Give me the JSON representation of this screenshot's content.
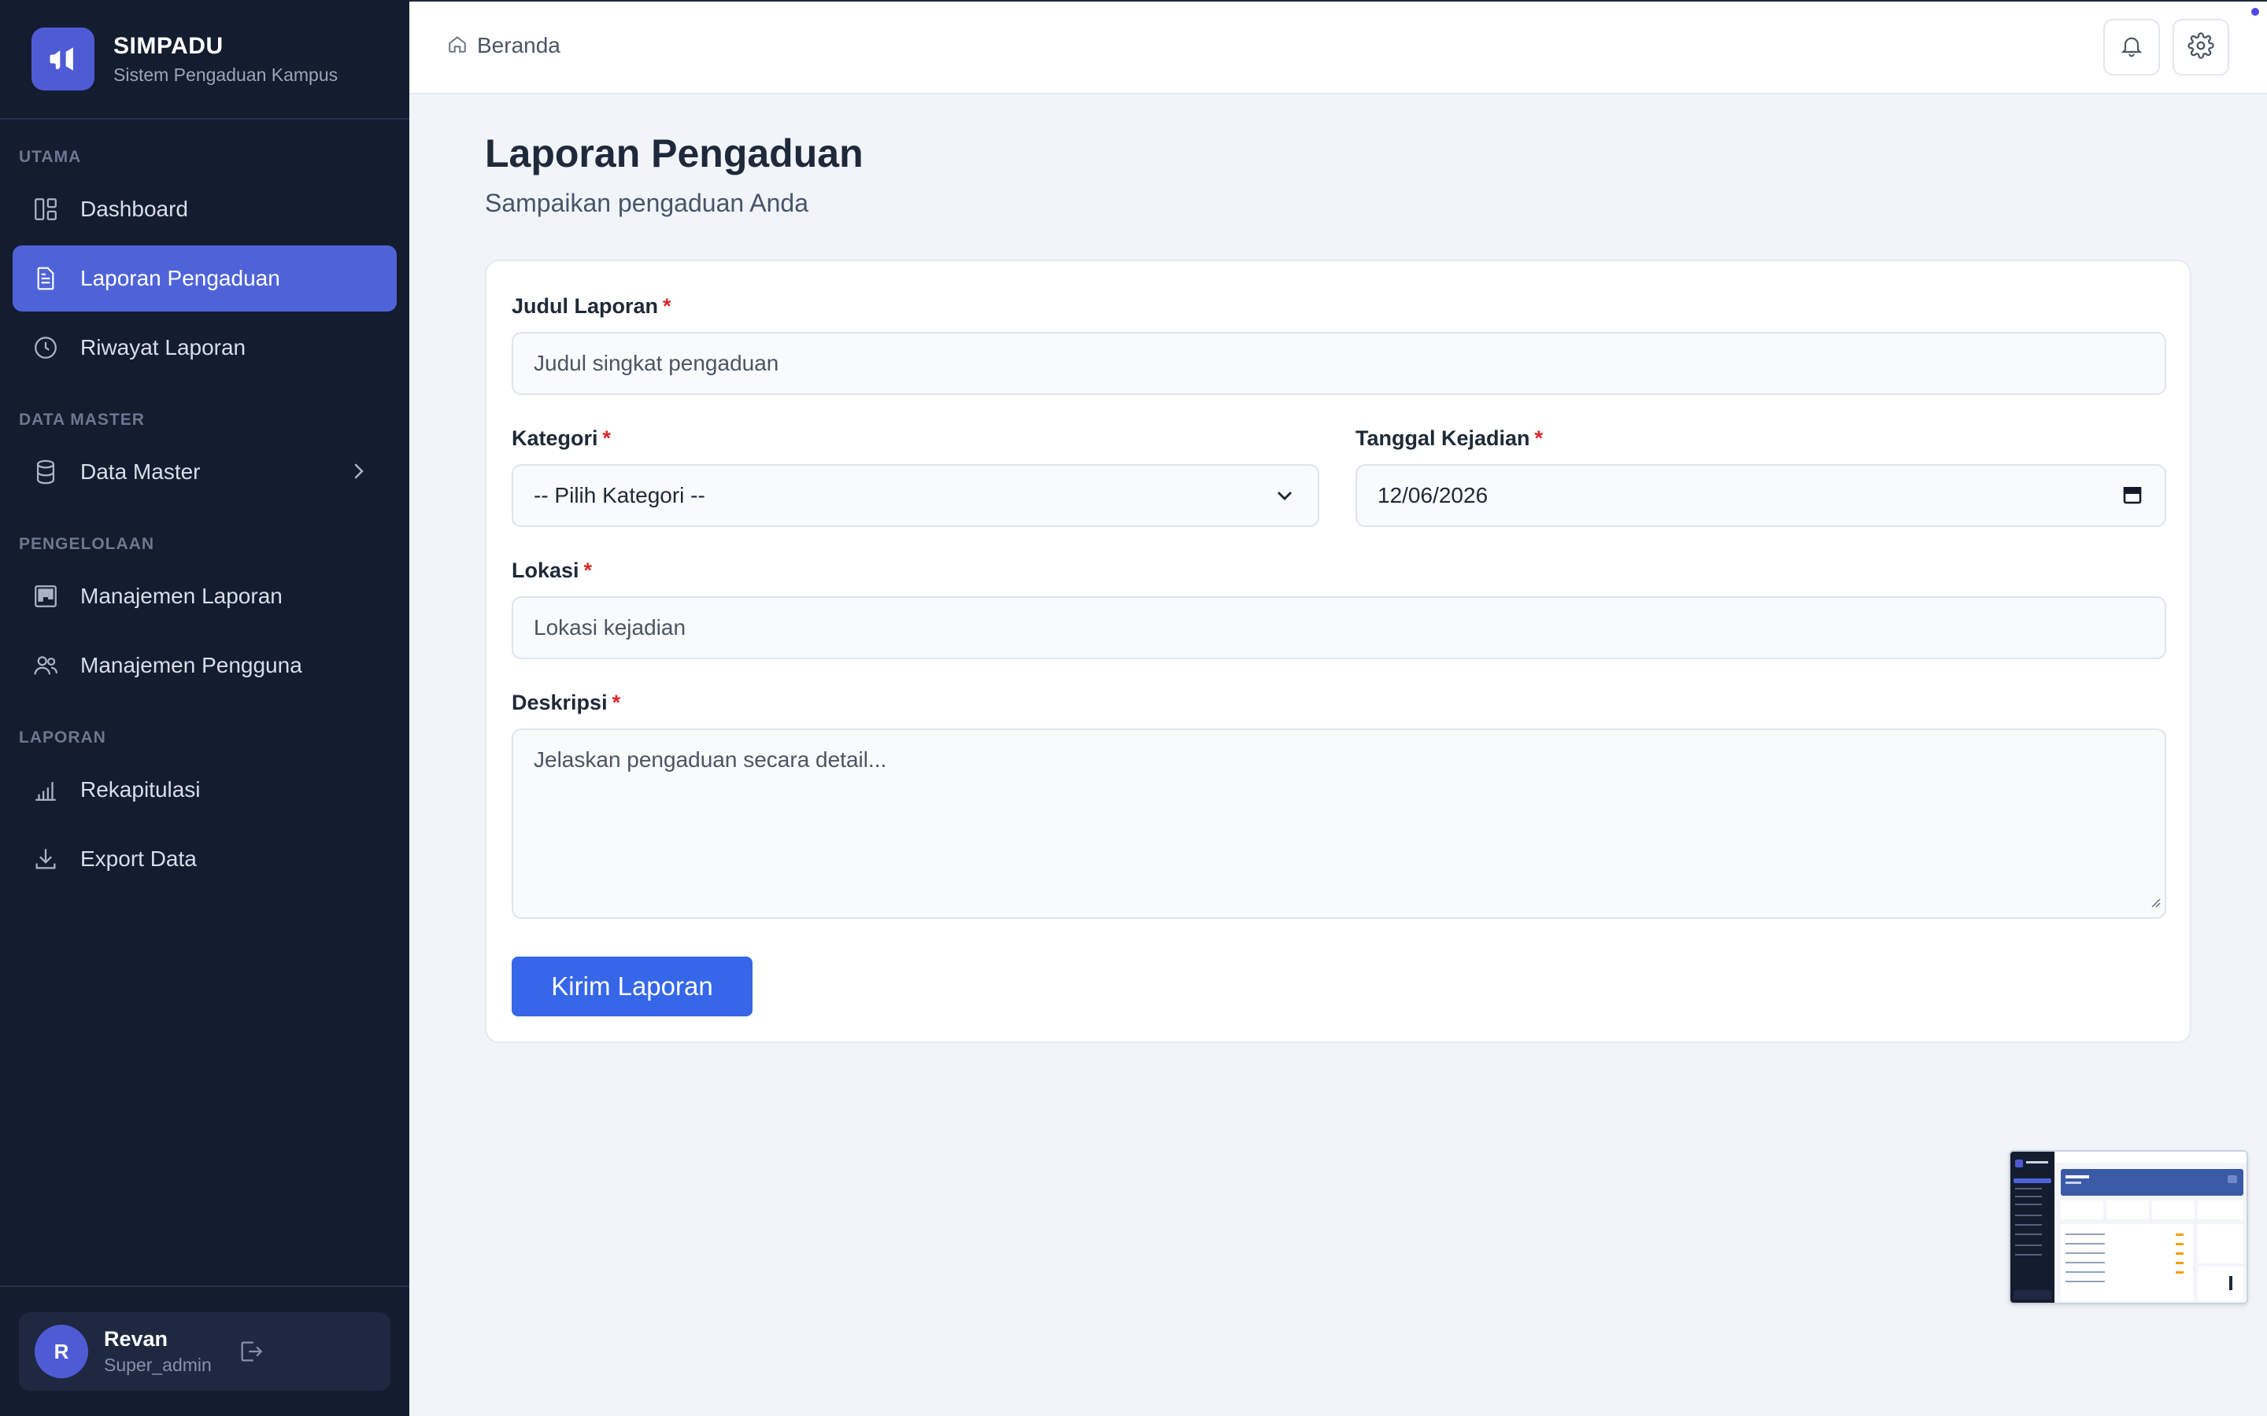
{
  "app": {
    "title": "SIMPADU",
    "subtitle": "Sistem Pengaduan Kampus"
  },
  "colors": {
    "sidebar_bg": "#141c2f",
    "accent": "#4f63d9",
    "primary_button": "#3567e8",
    "required": "#dc2626"
  },
  "sidebar": {
    "sections": [
      {
        "label": "UTAMA"
      },
      {
        "label": "DATA MASTER"
      },
      {
        "label": "PENGELOLAAN"
      },
      {
        "label": "LAPORAN"
      }
    ],
    "items": [
      {
        "label": "Dashboard",
        "icon": "dashboard-icon",
        "active": false
      },
      {
        "label": "Laporan Pengaduan",
        "icon": "document-icon",
        "active": true
      },
      {
        "label": "Riwayat Laporan",
        "icon": "clock-icon",
        "active": false
      },
      {
        "label": "Data Master",
        "icon": "database-icon",
        "active": false,
        "has_submenu": true
      },
      {
        "label": "Manajemen Laporan",
        "icon": "kanban-icon",
        "active": false
      },
      {
        "label": "Manajemen Pengguna",
        "icon": "users-icon",
        "active": false
      },
      {
        "label": "Rekapitulasi",
        "icon": "bar-chart-icon",
        "active": false
      },
      {
        "label": "Export Data",
        "icon": "download-icon",
        "active": false
      }
    ]
  },
  "user": {
    "initial": "R",
    "name": "Revan",
    "role": "Super_admin"
  },
  "topbar": {
    "breadcrumb": "Beranda"
  },
  "page": {
    "title": "Laporan Pengaduan",
    "subtitle": "Sampaikan pengaduan Anda"
  },
  "form": {
    "required_mark": "*",
    "judul": {
      "label": "Judul Laporan",
      "placeholder": "Judul singkat pengaduan"
    },
    "kategori": {
      "label": "Kategori",
      "selected": "-- Pilih Kategori --"
    },
    "tanggal": {
      "label": "Tanggal Kejadian",
      "value": "12/06/2026"
    },
    "lokasi": {
      "label": "Lokasi",
      "placeholder": "Lokasi kejadian"
    },
    "deskripsi": {
      "label": "Deskripsi",
      "placeholder": "Jelaskan pengaduan secara detail..."
    },
    "submit_label": "Kirim Laporan"
  }
}
